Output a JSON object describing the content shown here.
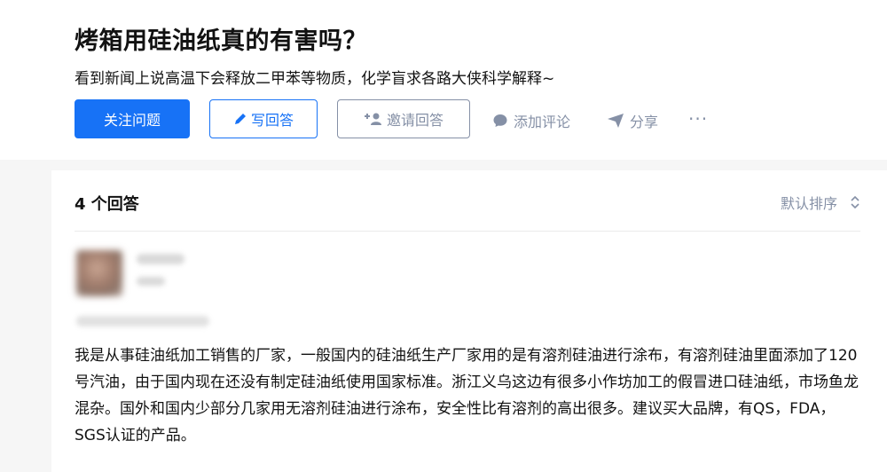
{
  "question": {
    "title": "烤箱用硅油纸真的有害吗？",
    "detail": "看到新闻上说高温下会释放二甲苯等物质，化学盲求各路大侠科学解释~"
  },
  "buttons": {
    "follow": "关注问题",
    "write": "写回答",
    "invite": "邀请回答"
  },
  "actions": {
    "comment": "添加评论",
    "share": "分享",
    "more": "···"
  },
  "answers_section": {
    "count_label": "4 个回答",
    "sort_label": "默认排序"
  },
  "answer": {
    "text": "我是从事硅油纸加工销售的厂家，一般国内的硅油纸生产厂家用的是有溶剂硅油进行涂布，有溶剂硅油里面添加了120号汽油，由于国内现在还没有制定硅油纸使用国家标准。浙江义乌这边有很多小作坊加工的假冒进口硅油纸，市场鱼龙混杂。国外和国内少部分几家用无溶剂硅油进行涂布，安全性比有溶剂的高出很多。建议买大品牌，有QS，FDA，SGS认证的产品。"
  },
  "colors": {
    "primary": "#1772f6",
    "muted": "#8590a6",
    "text": "#121212"
  },
  "icons": [
    "pencil-icon",
    "add-user-icon",
    "comment-bubble-icon",
    "paper-plane-icon",
    "sort-arrows-icon"
  ]
}
